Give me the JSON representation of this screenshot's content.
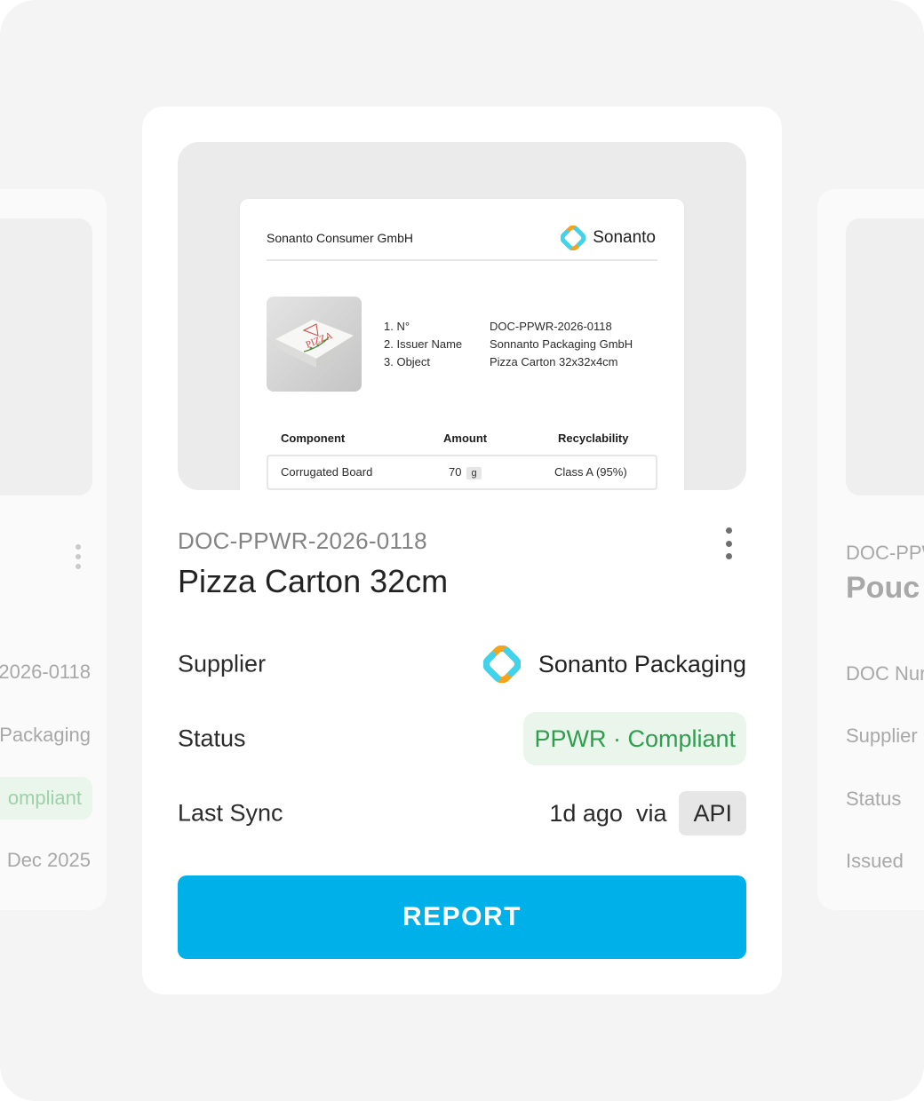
{
  "colors": {
    "background": "#f4f4f4",
    "card": "#ffffff",
    "accent": "#00b0e8",
    "status_green": "#2f9e4f",
    "status_bg": "#eaf5ec",
    "logo_orange": "#f7a21b",
    "logo_cyan": "#3fd3ec"
  },
  "left_card": {
    "doc_number_fragment": "2026-0118",
    "supplier_fragment": "Packaging",
    "status_fragment": "ompliant",
    "issued_fragment": "Dec 2025",
    "menu_icon": "more-vertical-icon"
  },
  "right_card": {
    "doc_id_fragment": "DOC-PPW",
    "title_fragment": "Pouc",
    "labels": {
      "doc_number": "DOC Nur",
      "supplier": "Supplier",
      "status": "Status",
      "issued": "Issued"
    }
  },
  "document_preview": {
    "company": "Sonanto Consumer GmbH",
    "brand_name": "Sonanto",
    "brand_icon": "sonanto-logo-icon",
    "photo_icon": "pizza-box-photo",
    "fields": [
      {
        "label": "1. N°",
        "value": "DOC-PPWR-2026-0118"
      },
      {
        "label": "2. Issuer Name",
        "value": "Sonnanto Packaging GmbH"
      },
      {
        "label": "3. Object",
        "value": "Pizza Carton 32x32x4cm"
      }
    ],
    "table": {
      "headers": {
        "component": "Component",
        "amount": "Amount",
        "recyclability": "Recyclability"
      },
      "rows": [
        {
          "component": "Corrugated Board",
          "amount": "70",
          "unit": "g",
          "recyclability": "Class A (95%)"
        }
      ]
    }
  },
  "card": {
    "doc_id": "DOC-PPWR-2026-0118",
    "title": "Pizza Carton 32cm",
    "menu_icon": "more-vertical-icon",
    "supplier": {
      "label": "Supplier",
      "name": "Sonanto Packaging",
      "icon": "sonanto-logo-icon"
    },
    "status": {
      "label": "Status",
      "value": "PPWR · Compliant"
    },
    "last_sync": {
      "label": "Last Sync",
      "value": "1d ago  via",
      "source": "API"
    },
    "report_button": "REPORT"
  }
}
